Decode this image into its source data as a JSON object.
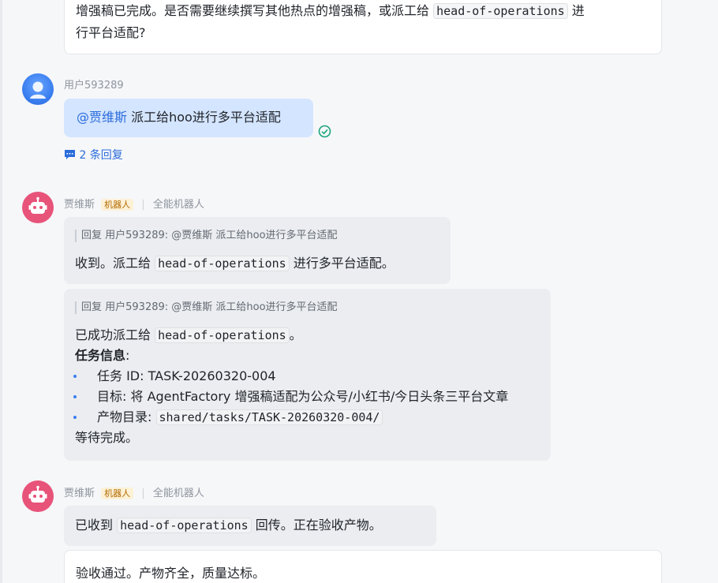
{
  "message_top": {
    "text_a": "增强稿已完成。是否需要继续撰写其他热点的增强稿，或派工给",
    "code": "head-of-operations",
    "text_b": "进",
    "text_c": "行平台适配?"
  },
  "user_msg": {
    "name": "用户593289",
    "mention": "@贾维斯",
    "text": "派工给hoo进行多平台适配",
    "replies": "2 条回复"
  },
  "bot1": {
    "name": "贾维斯",
    "tag": "机器人",
    "role": "全能机器人",
    "msg1": {
      "quote": "回复 用户593289:  @贾维斯 派工给hoo进行多平台适配",
      "text_a": "收到。派工给",
      "code": "head-of-operations",
      "text_b": "进行多平台适配。"
    },
    "msg2": {
      "quote": "回复 用户593289:  @贾维斯 派工给hoo进行多平台适配",
      "line1_a": "已成功派工给",
      "line1_code": "head-of-operations",
      "line1_b": "。",
      "heading": "任务信息",
      "heading_colon": ":",
      "item1": "任务 ID: TASK-20260320-004",
      "item2": "目标: 将 AgentFactory 增强稿适配为公众号/小红书/今日头条三平台文章",
      "item3_label": "产物目录:",
      "item3_code": "shared/tasks/TASK-20260320-004/",
      "closing": "等待完成。"
    }
  },
  "bot2": {
    "name": "贾维斯",
    "tag": "机器人",
    "role": "全能机器人",
    "msg1": {
      "text_a": "已收到",
      "code": "head-of-operations",
      "text_b": "回传。正在验收产物。"
    },
    "msg2": {
      "text": "验收通过。产物齐全，质量达标。"
    }
  },
  "colors": {
    "accent": "#2a6cdb",
    "user_bubble": "#d4e5ff",
    "bot_avatar": "#e8537a",
    "read_check": "#1aa57c"
  }
}
